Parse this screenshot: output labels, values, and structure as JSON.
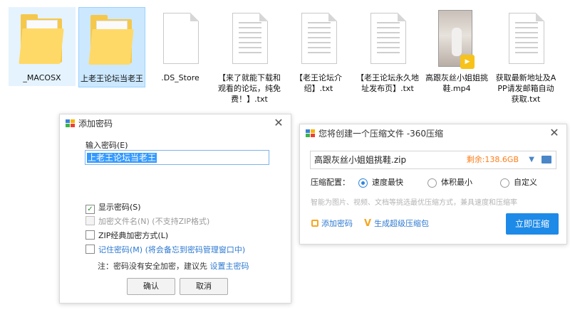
{
  "files": [
    {
      "label": "_MACOSX",
      "type": "folder"
    },
    {
      "label": "上老王论坛当老王",
      "type": "folder"
    },
    {
      "label": ".DS_Store",
      "type": "blank"
    },
    {
      "label": "【来了就能下载和观看的论坛，纯免费！】.txt",
      "type": "text"
    },
    {
      "label": "【老王论坛介绍】.txt",
      "type": "text"
    },
    {
      "label": "【老王论坛永久地址发布页】.txt",
      "type": "text"
    },
    {
      "label": "高跟灰丝小姐姐挑鞋.mp4",
      "type": "video"
    },
    {
      "label": "获取最新地址及APP请发邮箱自动获取.txt",
      "type": "text"
    }
  ],
  "password_dialog": {
    "title": "添加密码",
    "input_label": "输入密码(E)",
    "password_value": "上老王论坛当老王",
    "options": [
      {
        "label": "显示密码(S)",
        "checked": true,
        "disabled": false
      },
      {
        "label": "加密文件名(N) (不支持ZIP格式)",
        "checked": false,
        "disabled": true
      },
      {
        "label": "ZIP经典加密方式(L)",
        "checked": false,
        "disabled": false
      },
      {
        "label": "记住密码(M) (将会备忘到密码管理窗口中)",
        "checked": false,
        "disabled": false
      }
    ],
    "note_prefix": "注：密码没有安全加密，建议先",
    "note_link": "设置主密码",
    "ok_label": "确认",
    "cancel_label": "取消"
  },
  "zip_dialog": {
    "title": "您将创建一个压缩文件 -360压缩",
    "file_name": "高跟灰丝小姐姐挑鞋.zip",
    "space_left": "剩余:138.6GB",
    "config_label": "压缩配置：",
    "modes": [
      {
        "label": "速度最快",
        "selected": true
      },
      {
        "label": "体积最小",
        "selected": false
      },
      {
        "label": "自定义",
        "selected": false
      }
    ],
    "hint": "智能为图片、视频、文档等挑选最优压缩方式，兼具速度和压缩率",
    "add_password_label": "添加密码",
    "super_zip_label": "生成超级压缩包",
    "compress_now_label": "立即压缩"
  },
  "colors": {
    "accent": "#1e8ae8",
    "selection": "#cce8ff",
    "folder": "#f5c84c",
    "warning": "#ff7d19"
  }
}
